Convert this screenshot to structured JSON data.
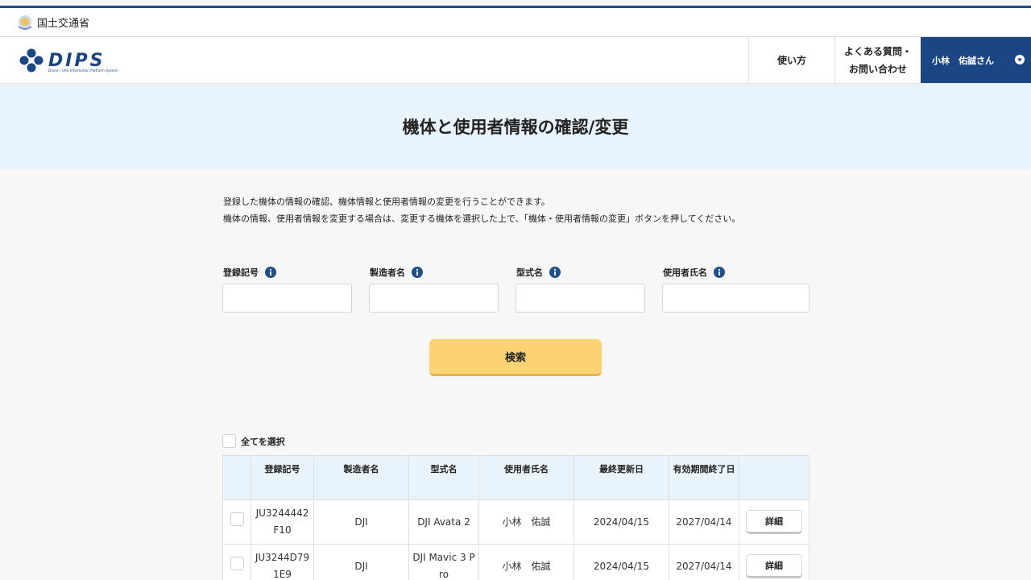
{
  "ministry": {
    "name": "国土交通省"
  },
  "header": {
    "logo_alt": "DIPS",
    "logo_text": "DIPS",
    "logo_tagline": "Drone / UAS Information Platform System",
    "nav": {
      "howto": "使い方",
      "faq_line1": "よくある質問・",
      "faq_line2": "お問い合わせ"
    },
    "user": {
      "name": "小林　佑誠さん"
    }
  },
  "page": {
    "title": "機体と使用者情報の確認/変更",
    "description_line1": "登録した機体の情報の確認、機体情報と使用者情報の変更を行うことができます。",
    "description_line2": "機体の情報、使用者情報を変更する場合は、変更する機体を選択した上で、「機体・使用者情報の変更」ボタンを押してください。"
  },
  "search": {
    "fields": [
      {
        "label": "登録記号",
        "value": "",
        "placeholder": ""
      },
      {
        "label": "製造者名",
        "value": "",
        "placeholder": ""
      },
      {
        "label": "型式名",
        "value": "",
        "placeholder": ""
      },
      {
        "label": "使用者氏名",
        "value": "",
        "placeholder": ""
      }
    ],
    "button_label": "検索"
  },
  "results": {
    "select_all_label": "全てを選択",
    "columns": [
      "登録記号",
      "製造者名",
      "型式名",
      "使用者氏名",
      "最終更新日",
      "有効期間終了日"
    ],
    "rows": [
      {
        "reg_line1": "JU3244442",
        "reg_line2": "F10",
        "maker": "DJI",
        "model_line1": "DJI Avata 2",
        "model_line2": "",
        "user": "小林　佑誠",
        "updated": "2024/04/15",
        "expires": "2027/04/14",
        "detail_label": "詳細"
      },
      {
        "reg_line1": "JU3244D79",
        "reg_line2": "1E9",
        "maker": "DJI",
        "model_line1": "DJI Mavic 3 P",
        "model_line2": "ro",
        "user": "小林　佑誠",
        "updated": "2024/04/15",
        "expires": "2027/04/14",
        "detail_label": "詳細"
      }
    ]
  },
  "colors": {
    "brand_blue": "#1b4684",
    "title_band": "#e9f3fc",
    "search_button": "#fbd373",
    "info_icon": "#1e4e8c"
  },
  "icons": {
    "ministry": "mlit-logo-icon",
    "info": "info-circle-icon",
    "user_menu": "caret-down-circle-icon"
  }
}
